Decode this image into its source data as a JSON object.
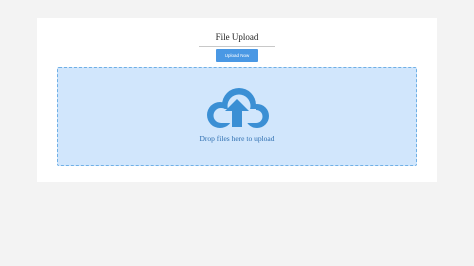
{
  "upload": {
    "title": "File Upload",
    "button_label": "Upload Now",
    "drop_text": "Drop files here to upload"
  },
  "icons": {
    "cloud": "cloud-upload-icon"
  },
  "colors": {
    "page_background": "#f3f3f3",
    "card_background": "#ffffff",
    "button": "#4a98e4",
    "dropzone_background": "#d1e6fc",
    "dropzone_border": "#6fb0e6",
    "cloud_icon": "#3b8fd4",
    "drop_text": "#2f6fb0"
  }
}
